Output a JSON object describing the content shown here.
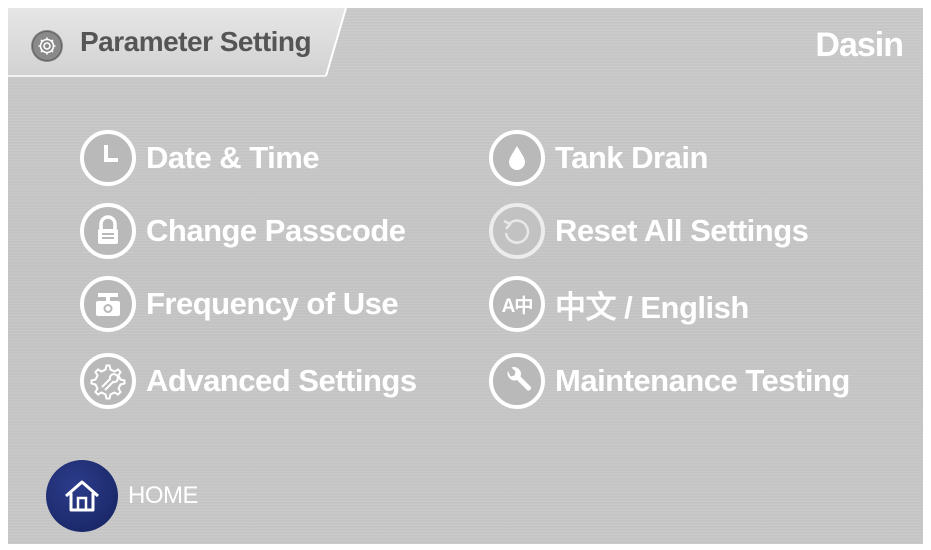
{
  "header": {
    "title": "Parameter Setting",
    "title_icon": "gear-icon",
    "brand": "Dasin"
  },
  "menu": {
    "left": [
      {
        "label": "Date & Time",
        "icon": "clock-icon"
      },
      {
        "label": "Change Passcode",
        "icon": "lock-icon"
      },
      {
        "label": "Frequency of Use",
        "icon": "usage-counter-icon"
      },
      {
        "label": "Advanced Settings",
        "icon": "advanced-settings-icon"
      }
    ],
    "right": [
      {
        "label": "Tank Drain",
        "icon": "water-drop-icon"
      },
      {
        "label": "Reset All Settings",
        "icon": "reset-icon"
      },
      {
        "label": "中文 / English",
        "icon": "language-icon",
        "icon_text": "A中"
      },
      {
        "label": "Maintenance Testing",
        "icon": "wrench-icon"
      }
    ]
  },
  "footer": {
    "home_label": "HOME",
    "home_icon": "home-icon"
  },
  "colors": {
    "background": "#c7c7c7",
    "text": "#ffffff",
    "title_text": "#555555",
    "home_button": "#1c2a6c"
  }
}
